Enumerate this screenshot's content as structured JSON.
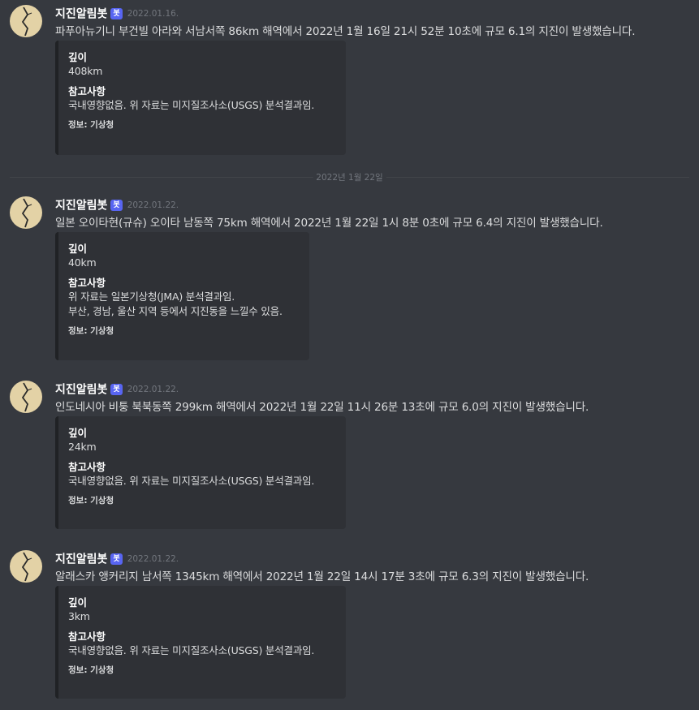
{
  "messages": [
    {
      "username": "지진알림봇",
      "bot_tag": "봇",
      "timestamp": "2022.01.16.",
      "content": "파푸아뉴기니 부건빌 아라와 서남서쪽 86km 해역에서 2022년 1월 16일 21시 52분 10초에 규모 6.1의 지진이 발생했습니다.",
      "embed": {
        "depth_name": "깊이",
        "depth_value": "408km",
        "note_name": "참고사항",
        "note_lines": [
          "국내영향없음. 위 자료는 미지질조사소(USGS) 분석결과임."
        ],
        "footer": "정보: 기상청"
      }
    },
    {
      "username": "지진알림봇",
      "bot_tag": "봇",
      "timestamp": "2022.01.22.",
      "content": "일본 오이타현(규슈) 오이타 남동쪽 75km 해역에서 2022년 1월 22일 1시 8분 0초에 규모 6.4의 지진이 발생했습니다.",
      "embed": {
        "depth_name": "깊이",
        "depth_value": "40km",
        "note_name": "참고사항",
        "note_lines": [
          "위 자료는 일본기상청(JMA) 분석결과임.",
          "부산, 경남, 울산 지역 등에서 지진동을 느낄수 있음."
        ],
        "footer": "정보: 기상청"
      }
    },
    {
      "username": "지진알림봇",
      "bot_tag": "봇",
      "timestamp": "2022.01.22.",
      "content": "인도네시아 비퉁 북북동쪽 299km 해역에서 2022년 1월 22일 11시 26분 13초에 규모 6.0의 지진이 발생했습니다.",
      "embed": {
        "depth_name": "깊이",
        "depth_value": "24km",
        "note_name": "참고사항",
        "note_lines": [
          "국내영향없음. 위 자료는 미지질조사소(USGS) 분석결과임."
        ],
        "footer": "정보: 기상청"
      }
    },
    {
      "username": "지진알림봇",
      "bot_tag": "봇",
      "timestamp": "2022.01.22.",
      "content": "알래스카 앵커리지 남서쪽 1345km 해역에서 2022년 1월 22일 14시 17분 3초에 규모 6.3의 지진이 발생했습니다.",
      "embed": {
        "depth_name": "깊이",
        "depth_value": "3km",
        "note_name": "참고사항",
        "note_lines": [
          "국내영향없음. 위 자료는 미지질조사소(USGS) 분석결과임."
        ],
        "footer": "정보: 기상청"
      }
    }
  ],
  "date_divider": "2022년 1월 22일",
  "colors": {
    "background": "#36393f",
    "embed_background": "#2f3136",
    "bot_tag": "#5865f2",
    "avatar": "#e3d2a6"
  },
  "avatar_icon": "crack-icon"
}
